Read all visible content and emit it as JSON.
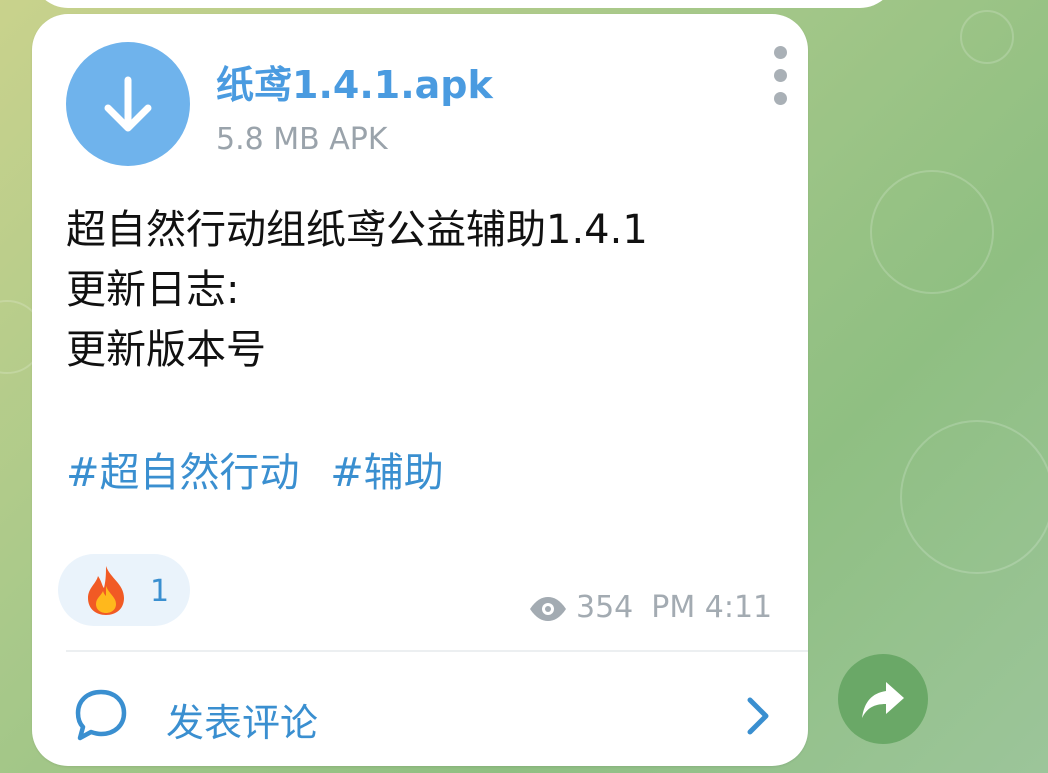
{
  "file": {
    "name": "纸鸢1.4.1.apk",
    "meta": "5.8 MB APK",
    "icon": "download-arrow-icon"
  },
  "message": {
    "text": "超自然行动组纸鸢公益辅助1.4.1\n更新日志:\n更新版本号",
    "tags": [
      "#超自然行动",
      "#辅助"
    ]
  },
  "reaction": {
    "emoji": "🔥",
    "count": "1"
  },
  "footer": {
    "views": "354",
    "time": "PM 4:11"
  },
  "comments": {
    "label": "发表评论"
  },
  "colors": {
    "accent": "#3a8fd0",
    "file_icon_bg": "#6fb3ec",
    "share_bg": "#6aa867"
  }
}
